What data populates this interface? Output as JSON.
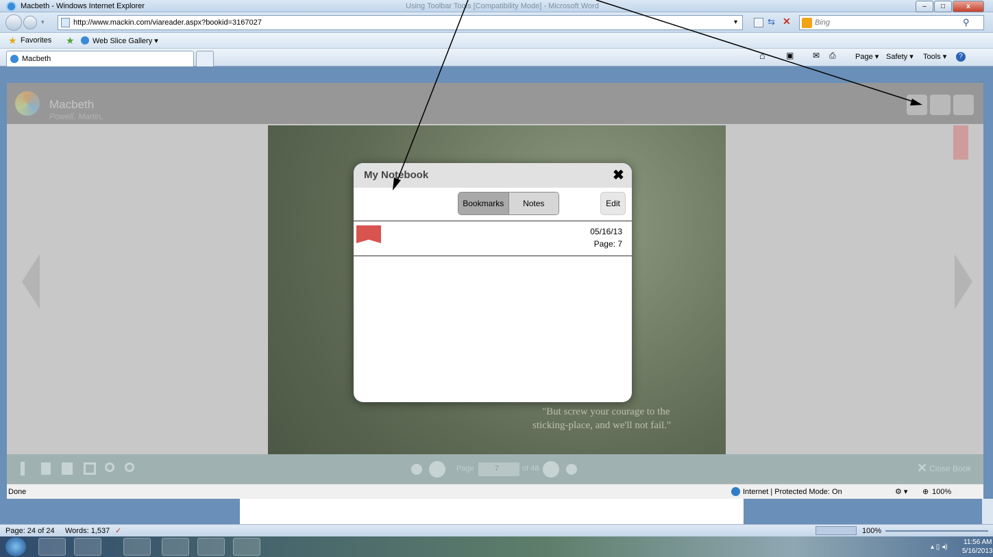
{
  "window": {
    "title": "Macbeth - Windows Internet Explorer",
    "background_title": "Using Toolbar Tools [Compatibility Mode] - Microsoft Word",
    "min": "–",
    "max": "□",
    "close": "x"
  },
  "nav": {
    "url": "http://www.mackin.com/viareader.aspx?bookid=3167027",
    "search_placeholder": "Bing"
  },
  "favorites": {
    "label": "Favorites",
    "web_slice": "Web Slice Gallery ▾"
  },
  "tabs": {
    "active": "Macbeth"
  },
  "command_bar": {
    "page": "Page ▾",
    "safety": "Safety ▾",
    "tools": "Tools ▾"
  },
  "reader": {
    "title": "Macbeth",
    "author": "Powell, Martin,",
    "quote_line1": "\"But screw your courage to the",
    "quote_line2": "sticking-place, and we'll not fail.\"",
    "page_label": "Page",
    "page_value": "7",
    "page_of": "of 48",
    "close_book": "Close Book"
  },
  "notebook": {
    "title": "My Notebook",
    "close": "✖",
    "tab_bookmarks": "Bookmarks",
    "tab_notes": "Notes",
    "edit": "Edit",
    "bookmark_date": "05/16/13",
    "bookmark_page": "Page: 7"
  },
  "statusbar": {
    "left": "Done",
    "zone": "Internet | Protected Mode: On",
    "zoom": "100%"
  },
  "word_status": {
    "page": "Page: 24 of 24",
    "words": "Words: 1,537",
    "zoom": "100%"
  },
  "taskbar": {
    "time": "11:56 AM",
    "date": "5/16/2013"
  },
  "colors": {
    "bookmark_flag": "#d9534f",
    "reader_bg": "#c8c8c8",
    "overlay": "#979797"
  }
}
